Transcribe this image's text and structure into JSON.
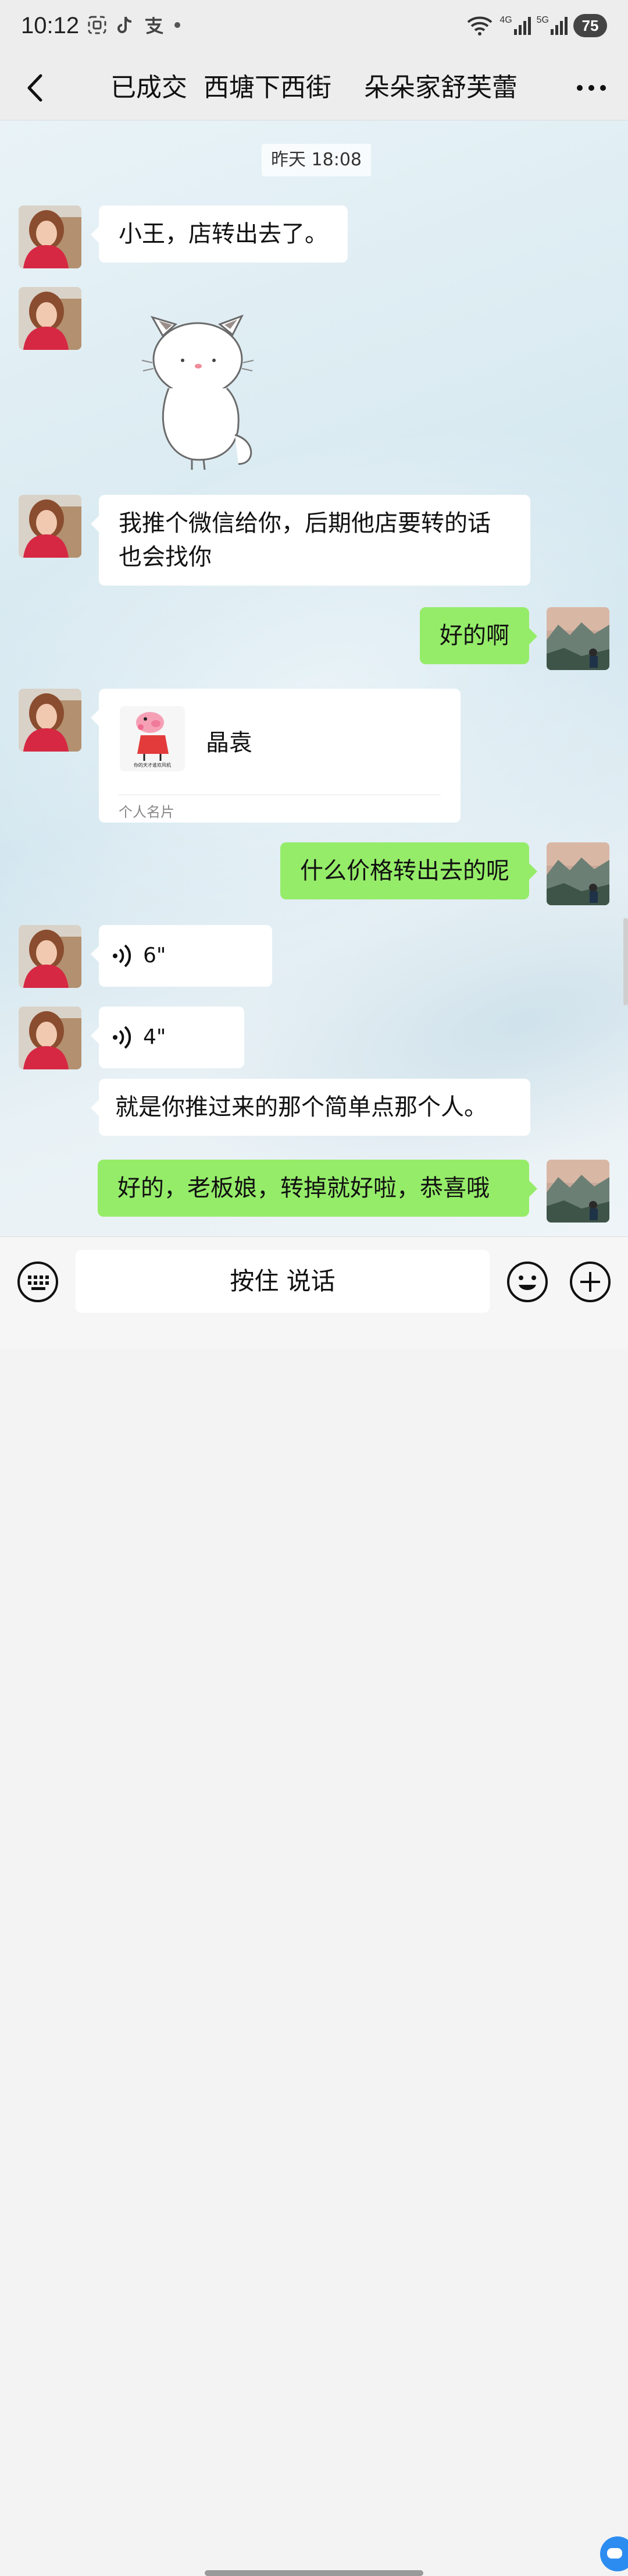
{
  "status_bar": {
    "time": "10:12",
    "battery": "75",
    "signal_labels": [
      "4G",
      "5G"
    ]
  },
  "nav": {
    "title": "已成交  西塘下西街    朵朵家舒芙蕾"
  },
  "chat": {
    "timestamp": "昨天 18:08",
    "messages": [
      {
        "from": "other",
        "type": "text",
        "text": "小王，店转出去了。"
      },
      {
        "from": "other",
        "type": "sticker",
        "sticker": "white-cat-sticker"
      },
      {
        "from": "other",
        "type": "text",
        "text": "我推个微信给你，后期他店要转的话也会找你"
      },
      {
        "from": "self",
        "type": "text",
        "text": "好的啊"
      },
      {
        "from": "other",
        "type": "contact_card",
        "name": "晶袁",
        "card_avatar_text": "你的天才谁欢风机",
        "label": "个人名片"
      },
      {
        "from": "self",
        "type": "text",
        "text": "什么价格转出去的呢"
      },
      {
        "from": "other",
        "type": "voice",
        "duration": "6\""
      },
      {
        "from": "other",
        "type": "voice",
        "duration": "4\""
      },
      {
        "from": "other",
        "type": "text",
        "text": "就是你推过来的那个简单点那个人。"
      },
      {
        "from": "self",
        "type": "text",
        "text": "好的，老板娘，转掉就好啦，恭喜哦"
      }
    ]
  },
  "input_bar": {
    "hold_to_talk": "按住 说话"
  },
  "colors": {
    "outgoing_bubble": "#95ec69",
    "incoming_bubble": "#ffffff"
  }
}
